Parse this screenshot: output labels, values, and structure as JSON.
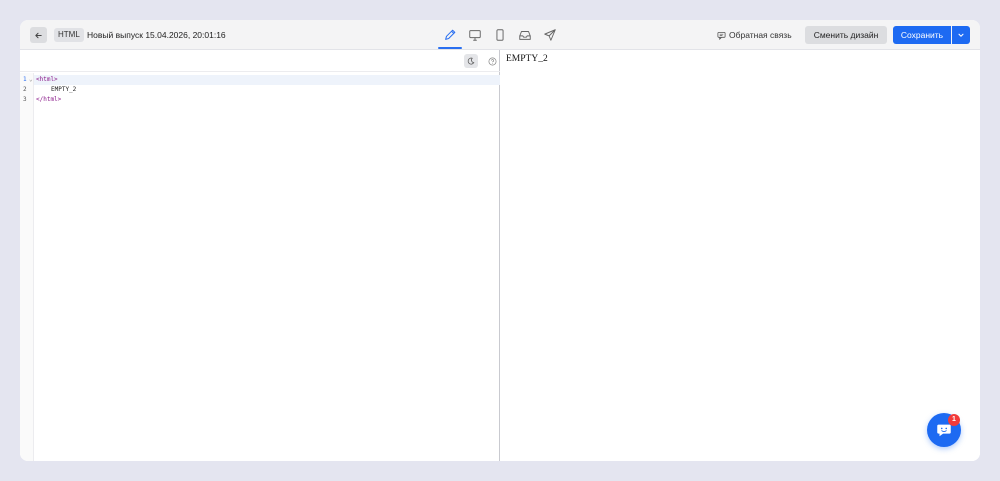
{
  "header": {
    "format_tag": "HTML",
    "title": "Новый выпуск 15.04.2026, 20:01:16",
    "tabs": [
      {
        "name": "edit",
        "icon": "pencil-icon",
        "active": true
      },
      {
        "name": "desktop-preview",
        "icon": "monitor-icon",
        "active": false
      },
      {
        "name": "mobile-preview",
        "icon": "phone-icon",
        "active": false
      },
      {
        "name": "inbox-preview",
        "icon": "inbox-icon",
        "active": false
      },
      {
        "name": "send",
        "icon": "send-icon",
        "active": false
      }
    ],
    "feedback_label": "Обратная связь",
    "change_design_label": "Сменить дизайн",
    "save_label": "Сохранить"
  },
  "editor": {
    "lines": [
      {
        "number": "1",
        "text": "<html>"
      },
      {
        "number": "2",
        "text": "EMPTY_2"
      },
      {
        "number": "3",
        "text": "</html>"
      }
    ]
  },
  "preview": {
    "text": "EMPTY_2"
  },
  "chat": {
    "badge_count": "1"
  },
  "colors": {
    "accent": "#1d6af2",
    "badge": "#f23a3a",
    "tag_code": "#8a1a8a"
  }
}
